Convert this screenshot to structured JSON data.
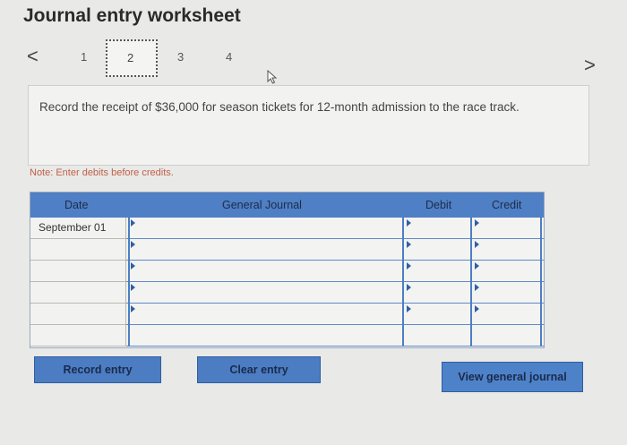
{
  "header": {
    "title": "Journal entry worksheet"
  },
  "navigation": {
    "prev_label": "<",
    "next_label": ">",
    "steps": [
      "1",
      "2",
      "3",
      "4"
    ],
    "active_step": "2"
  },
  "prompt": {
    "text": "Record the receipt of $36,000 for season tickets for 12-month admission to the race track."
  },
  "note": "Note: Enter debits before credits.",
  "journal": {
    "columns": {
      "date": "Date",
      "general_journal": "General Journal",
      "debit": "Debit",
      "credit": "Credit"
    },
    "rows": [
      {
        "date": "September 01",
        "account": "",
        "debit": "",
        "credit": ""
      },
      {
        "date": "",
        "account": "",
        "debit": "",
        "credit": ""
      },
      {
        "date": "",
        "account": "",
        "debit": "",
        "credit": ""
      },
      {
        "date": "",
        "account": "",
        "debit": "",
        "credit": ""
      },
      {
        "date": "",
        "account": "",
        "debit": "",
        "credit": ""
      },
      {
        "date": "",
        "account": "",
        "debit": "",
        "credit": ""
      }
    ]
  },
  "buttons": {
    "record_entry": "Record entry",
    "clear_entry": "Clear entry",
    "view_general_journal": "View general journal"
  },
  "colors": {
    "header_blue": "#4f7fc4",
    "button_blue": "#4c7dc3",
    "note_red": "#c0604a"
  }
}
